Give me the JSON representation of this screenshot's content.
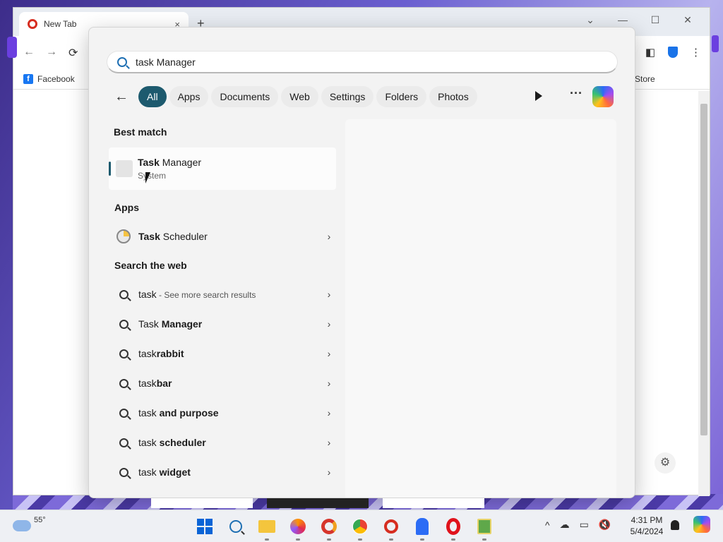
{
  "browser": {
    "tab_title": "New Tab",
    "tab_close": "×",
    "new_tab": "+",
    "bookmarks": [
      {
        "label": "Facebook"
      },
      {
        "label": "Store"
      }
    ]
  },
  "search": {
    "value": "task Manager"
  },
  "filters": [
    "All",
    "Apps",
    "Documents",
    "Web",
    "Settings",
    "Folders",
    "Photos"
  ],
  "sections": {
    "best_match": "Best match",
    "apps": "Apps",
    "web": "Search the web"
  },
  "best_match": {
    "title_bold": "Task",
    "title_rest": " Manager",
    "subtitle": "System"
  },
  "apps": [
    {
      "bold": "Task",
      "rest": " Scheduler"
    }
  ],
  "web_results": [
    {
      "bold": "task",
      "rest": "",
      "muted": " - See more search results"
    },
    {
      "bold": "",
      "pre": "Task ",
      "rest": "Manager",
      "muted": ""
    },
    {
      "pre": "task",
      "rest": "rabbit"
    },
    {
      "pre": "task",
      "rest": "bar"
    },
    {
      "pre": "task ",
      "rest": "and purpose"
    },
    {
      "pre": "task ",
      "rest": "scheduler"
    },
    {
      "pre": "task ",
      "rest": "widget"
    }
  ],
  "taskbar": {
    "temperature": "55°",
    "time": "4:31 PM",
    "date": "5/4/2024"
  },
  "colors": {
    "accent": "#1d5a6e",
    "search_icon": "#1e6fb3"
  }
}
